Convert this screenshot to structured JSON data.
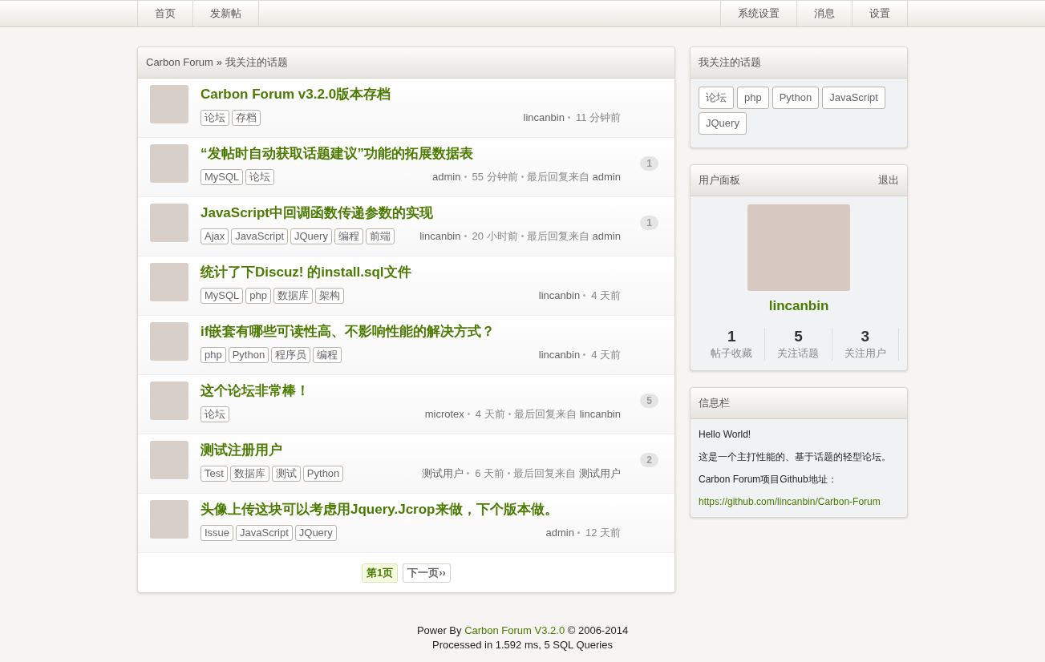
{
  "nav": {
    "left": [
      "首页",
      "发新帖"
    ],
    "right": [
      "系统设置",
      "消息",
      "设置"
    ]
  },
  "breadcrumb": {
    "home": "Carbon Forum",
    "separator": "»",
    "current": "我关注的话题"
  },
  "topics": [
    {
      "title": "Carbon Forum v3.2.0版本存档",
      "tags": [
        "论坛",
        "存档"
      ],
      "author": "lincanbin",
      "time": "11 分钟前"
    },
    {
      "title": "“发帖时自动获取话题建议”功能的拓展数据表",
      "tags": [
        "MySQL",
        "论坛"
      ],
      "author": "admin",
      "time": "55 分钟前",
      "last_reply_label": "最后回复来自",
      "last_reply_by": "admin",
      "replies": "1"
    },
    {
      "title": "JavaScript中回调函数传递参数的实现",
      "tags": [
        "Ajax",
        "JavaScript",
        "JQuery",
        "编程",
        "前端"
      ],
      "author": "lincanbin",
      "time": "20 小时前",
      "last_reply_label": "最后回复来自",
      "last_reply_by": "admin",
      "replies": "1"
    },
    {
      "title": "统计了下Discuz! 的install.sql文件",
      "tags": [
        "MySQL",
        "php",
        "数据库",
        "架构"
      ],
      "author": "lincanbin",
      "time": "4 天前"
    },
    {
      "title": "if嵌套有哪些可读性高、不影响性能的解决方式？",
      "tags": [
        "php",
        "Python",
        "程序员",
        "编程"
      ],
      "author": "lincanbin",
      "time": "4 天前"
    },
    {
      "title": "这个论坛非常棒！",
      "tags": [
        "论坛"
      ],
      "author": "microtex",
      "time": "4 天前",
      "last_reply_label": "最后回复来自",
      "last_reply_by": "lincanbin",
      "replies": "5"
    },
    {
      "title": "测试注册用户",
      "tags": [
        "Test",
        "数据库",
        "测试",
        "Python"
      ],
      "author": "测试用户",
      "time": "6 天前",
      "last_reply_label": "最后回复来自",
      "last_reply_by": "测试用户",
      "replies": "2"
    },
    {
      "title": "头像上传这块可以考虑用Jquery.Jcrop来做，下个版本做。",
      "tags": [
        "Issue",
        "JavaScript",
        "JQuery"
      ],
      "author": "admin",
      "time": "12 天前"
    }
  ],
  "pagination": [
    {
      "label": "第1页",
      "selected": true
    },
    {
      "label": "下一页››",
      "selected": false
    }
  ],
  "followed_topics": {
    "title": "我关注的话题",
    "tags": [
      "论坛",
      "php",
      "Python",
      "JavaScript",
      "JQuery"
    ]
  },
  "user_panel": {
    "title": "用户面板",
    "logout": "退出",
    "username": "lincanbin",
    "stats": [
      {
        "value": "1",
        "label": "帖子收藏"
      },
      {
        "value": "5",
        "label": "关注话题"
      },
      {
        "value": "3",
        "label": "关注用户"
      }
    ]
  },
  "info": {
    "title": "信息栏",
    "lines": [
      "Hello World!",
      "这是一个主打性能的、基于话题的轻型论坛。",
      "Carbon Forum项目Github地址："
    ],
    "link": "https://github.com/lincanbin/Carbon-Forum"
  },
  "footer": {
    "prefix": "Power By ",
    "link": "Carbon Forum V3.2.0",
    "suffix": " © 2006-2014",
    "stats": "Processed in 1.592 ms, 5 SQL Queries"
  }
}
